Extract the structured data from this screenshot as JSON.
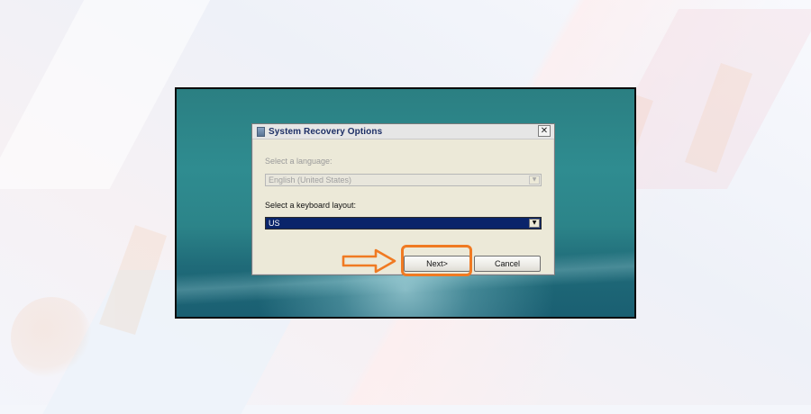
{
  "dialog": {
    "title": "System Recovery Options",
    "close_symbol": "✕",
    "language_label": "Select a language:",
    "language_value": "English (United States)",
    "keyboard_label": "Select a keyboard layout:",
    "keyboard_value": "US",
    "next_label": "Next>",
    "cancel_label": "Cancel"
  },
  "icons": {
    "title": "window-app-icon",
    "close": "close-icon",
    "dropdown": "chevron-down-icon",
    "annotation": "arrow-right-icon"
  },
  "colors": {
    "annotation_orange": "#f07a22",
    "title_text": "#1d2f66",
    "selection_blue": "#0a246a",
    "desktop_teal": "#2f8c90"
  }
}
